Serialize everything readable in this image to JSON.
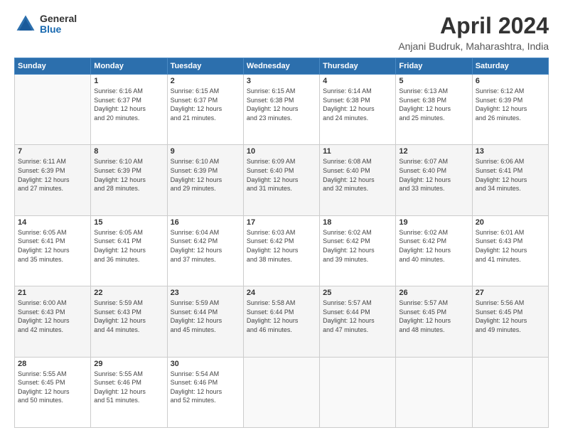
{
  "header": {
    "logo_general": "General",
    "logo_blue": "Blue",
    "title": "April 2024",
    "location": "Anjani Budruk, Maharashtra, India"
  },
  "days_of_week": [
    "Sunday",
    "Monday",
    "Tuesday",
    "Wednesday",
    "Thursday",
    "Friday",
    "Saturday"
  ],
  "weeks": [
    [
      {
        "day": "",
        "content": ""
      },
      {
        "day": "1",
        "content": "Sunrise: 6:16 AM\nSunset: 6:37 PM\nDaylight: 12 hours\nand 20 minutes."
      },
      {
        "day": "2",
        "content": "Sunrise: 6:15 AM\nSunset: 6:37 PM\nDaylight: 12 hours\nand 21 minutes."
      },
      {
        "day": "3",
        "content": "Sunrise: 6:15 AM\nSunset: 6:38 PM\nDaylight: 12 hours\nand 23 minutes."
      },
      {
        "day": "4",
        "content": "Sunrise: 6:14 AM\nSunset: 6:38 PM\nDaylight: 12 hours\nand 24 minutes."
      },
      {
        "day": "5",
        "content": "Sunrise: 6:13 AM\nSunset: 6:38 PM\nDaylight: 12 hours\nand 25 minutes."
      },
      {
        "day": "6",
        "content": "Sunrise: 6:12 AM\nSunset: 6:39 PM\nDaylight: 12 hours\nand 26 minutes."
      }
    ],
    [
      {
        "day": "7",
        "content": "Sunrise: 6:11 AM\nSunset: 6:39 PM\nDaylight: 12 hours\nand 27 minutes."
      },
      {
        "day": "8",
        "content": "Sunrise: 6:10 AM\nSunset: 6:39 PM\nDaylight: 12 hours\nand 28 minutes."
      },
      {
        "day": "9",
        "content": "Sunrise: 6:10 AM\nSunset: 6:39 PM\nDaylight: 12 hours\nand 29 minutes."
      },
      {
        "day": "10",
        "content": "Sunrise: 6:09 AM\nSunset: 6:40 PM\nDaylight: 12 hours\nand 31 minutes."
      },
      {
        "day": "11",
        "content": "Sunrise: 6:08 AM\nSunset: 6:40 PM\nDaylight: 12 hours\nand 32 minutes."
      },
      {
        "day": "12",
        "content": "Sunrise: 6:07 AM\nSunset: 6:40 PM\nDaylight: 12 hours\nand 33 minutes."
      },
      {
        "day": "13",
        "content": "Sunrise: 6:06 AM\nSunset: 6:41 PM\nDaylight: 12 hours\nand 34 minutes."
      }
    ],
    [
      {
        "day": "14",
        "content": "Sunrise: 6:05 AM\nSunset: 6:41 PM\nDaylight: 12 hours\nand 35 minutes."
      },
      {
        "day": "15",
        "content": "Sunrise: 6:05 AM\nSunset: 6:41 PM\nDaylight: 12 hours\nand 36 minutes."
      },
      {
        "day": "16",
        "content": "Sunrise: 6:04 AM\nSunset: 6:42 PM\nDaylight: 12 hours\nand 37 minutes."
      },
      {
        "day": "17",
        "content": "Sunrise: 6:03 AM\nSunset: 6:42 PM\nDaylight: 12 hours\nand 38 minutes."
      },
      {
        "day": "18",
        "content": "Sunrise: 6:02 AM\nSunset: 6:42 PM\nDaylight: 12 hours\nand 39 minutes."
      },
      {
        "day": "19",
        "content": "Sunrise: 6:02 AM\nSunset: 6:42 PM\nDaylight: 12 hours\nand 40 minutes."
      },
      {
        "day": "20",
        "content": "Sunrise: 6:01 AM\nSunset: 6:43 PM\nDaylight: 12 hours\nand 41 minutes."
      }
    ],
    [
      {
        "day": "21",
        "content": "Sunrise: 6:00 AM\nSunset: 6:43 PM\nDaylight: 12 hours\nand 42 minutes."
      },
      {
        "day": "22",
        "content": "Sunrise: 5:59 AM\nSunset: 6:43 PM\nDaylight: 12 hours\nand 44 minutes."
      },
      {
        "day": "23",
        "content": "Sunrise: 5:59 AM\nSunset: 6:44 PM\nDaylight: 12 hours\nand 45 minutes."
      },
      {
        "day": "24",
        "content": "Sunrise: 5:58 AM\nSunset: 6:44 PM\nDaylight: 12 hours\nand 46 minutes."
      },
      {
        "day": "25",
        "content": "Sunrise: 5:57 AM\nSunset: 6:44 PM\nDaylight: 12 hours\nand 47 minutes."
      },
      {
        "day": "26",
        "content": "Sunrise: 5:57 AM\nSunset: 6:45 PM\nDaylight: 12 hours\nand 48 minutes."
      },
      {
        "day": "27",
        "content": "Sunrise: 5:56 AM\nSunset: 6:45 PM\nDaylight: 12 hours\nand 49 minutes."
      }
    ],
    [
      {
        "day": "28",
        "content": "Sunrise: 5:55 AM\nSunset: 6:45 PM\nDaylight: 12 hours\nand 50 minutes."
      },
      {
        "day": "29",
        "content": "Sunrise: 5:55 AM\nSunset: 6:46 PM\nDaylight: 12 hours\nand 51 minutes."
      },
      {
        "day": "30",
        "content": "Sunrise: 5:54 AM\nSunset: 6:46 PM\nDaylight: 12 hours\nand 52 minutes."
      },
      {
        "day": "",
        "content": ""
      },
      {
        "day": "",
        "content": ""
      },
      {
        "day": "",
        "content": ""
      },
      {
        "day": "",
        "content": ""
      }
    ]
  ]
}
